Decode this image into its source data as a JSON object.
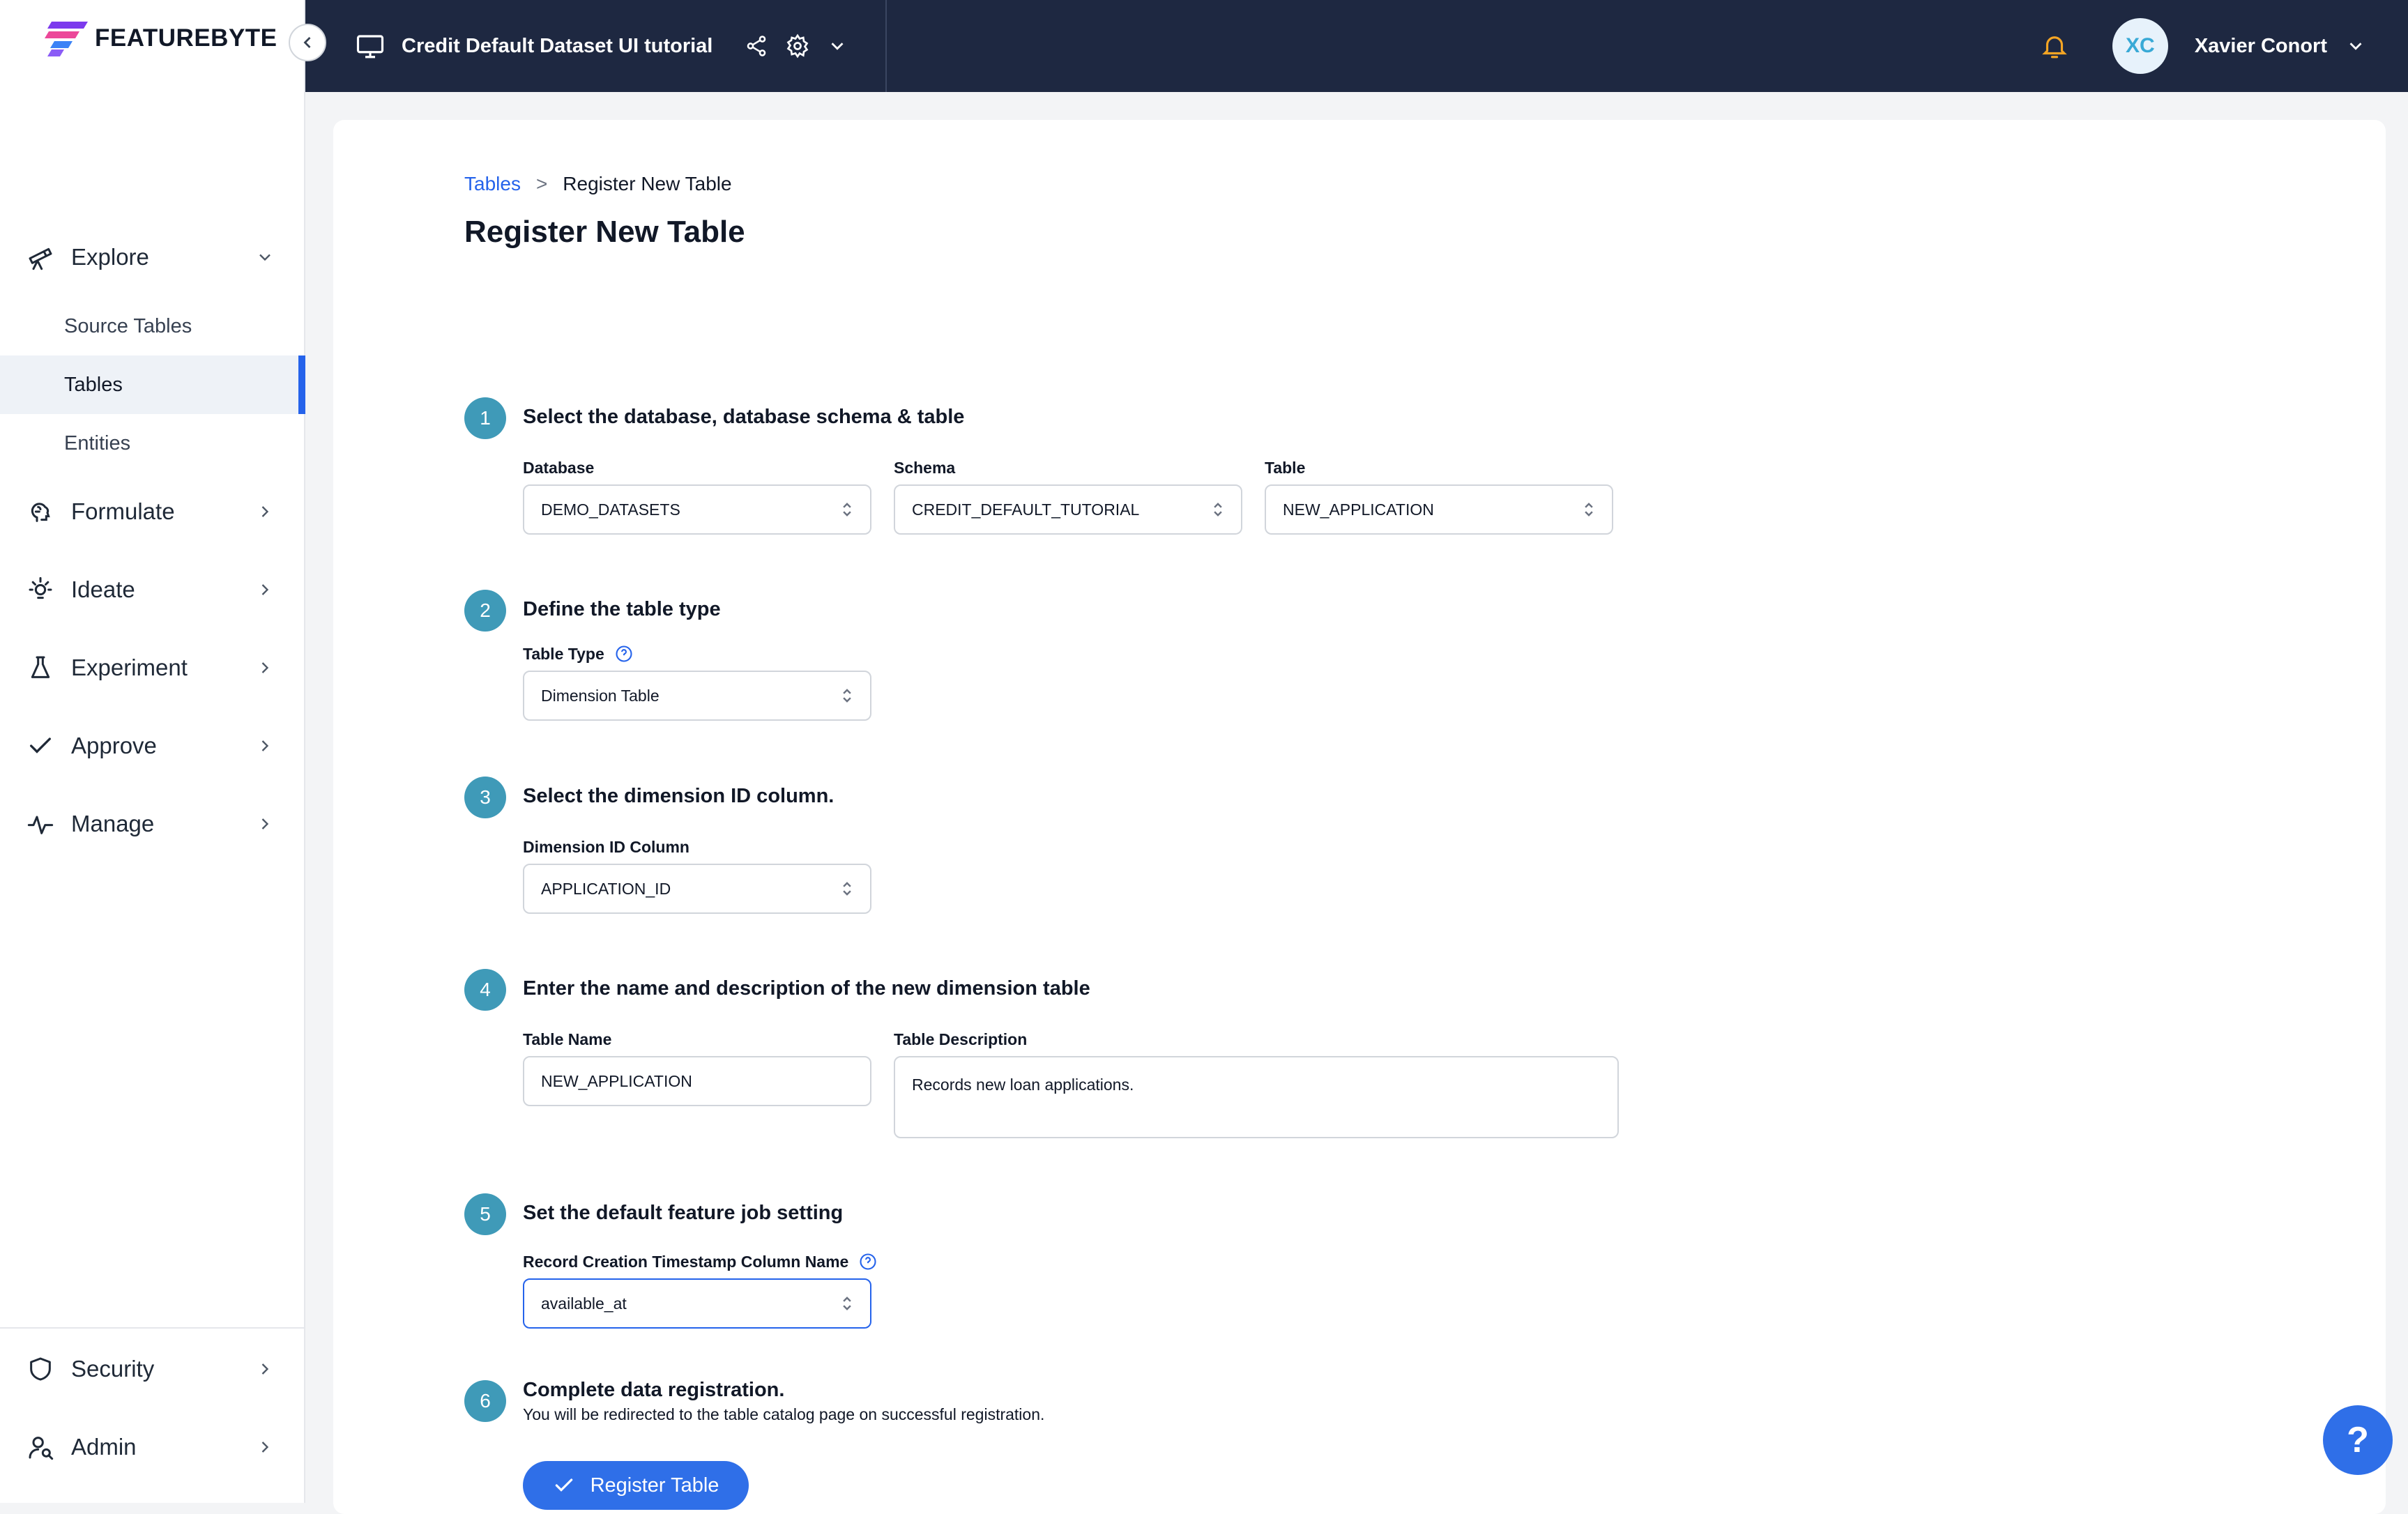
{
  "logo": {
    "text": "FEATUREBYTE"
  },
  "topbar": {
    "catalog_title": "Credit Default Dataset UI tutorial",
    "user_initials": "XC",
    "user_name": "Xavier Conort"
  },
  "sidebar": {
    "items": [
      {
        "label": "Explore",
        "icon": "telescope-icon",
        "expanded": true
      },
      {
        "label": "Formulate",
        "icon": "brain-icon"
      },
      {
        "label": "Ideate",
        "icon": "lightbulb-icon"
      },
      {
        "label": "Experiment",
        "icon": "flask-icon"
      },
      {
        "label": "Approve",
        "icon": "check-icon"
      },
      {
        "label": "Manage",
        "icon": "activity-icon"
      }
    ],
    "explore_sub": [
      "Source Tables",
      "Tables",
      "Entities"
    ],
    "active_sub": "Tables",
    "bottom_items": [
      {
        "label": "Security",
        "icon": "shield-icon"
      },
      {
        "label": "Admin",
        "icon": "user-search-icon"
      }
    ]
  },
  "breadcrumb": {
    "link": "Tables",
    "separator": ">",
    "current": "Register New Table"
  },
  "page_title": "Register New Table",
  "steps": [
    {
      "num": "1",
      "title": "Select the database, database schema & table"
    },
    {
      "num": "2",
      "title": "Define the table type"
    },
    {
      "num": "3",
      "title": "Select the dimension ID column."
    },
    {
      "num": "4",
      "title": "Enter the name and description of the new dimension table"
    },
    {
      "num": "5",
      "title": "Set the default feature job setting"
    },
    {
      "num": "6",
      "title": "Complete data registration.",
      "subtitle": "You will be redirected to the table catalog page on successful registration."
    }
  ],
  "fields": {
    "database": {
      "label": "Database",
      "value": "DEMO_DATASETS"
    },
    "schema": {
      "label": "Schema",
      "value": "CREDIT_DEFAULT_TUTORIAL"
    },
    "table": {
      "label": "Table",
      "value": "NEW_APPLICATION"
    },
    "table_type": {
      "label": "Table Type",
      "value": "Dimension Table"
    },
    "dimension_id": {
      "label": "Dimension ID Column",
      "value": "APPLICATION_ID"
    },
    "table_name": {
      "label": "Table Name",
      "value": "NEW_APPLICATION"
    },
    "table_description": {
      "label": "Table Description",
      "value": "Records new loan applications."
    },
    "record_ts": {
      "label": "Record Creation Timestamp Column Name",
      "value": "available_at"
    }
  },
  "register_button": {
    "label": "Register Table"
  },
  "help": {
    "label": "?"
  },
  "colors": {
    "accent": "#2f6fe8",
    "step_circle": "#3f9ab8",
    "topbar": "#1e2841",
    "bell": "#f5a524"
  }
}
